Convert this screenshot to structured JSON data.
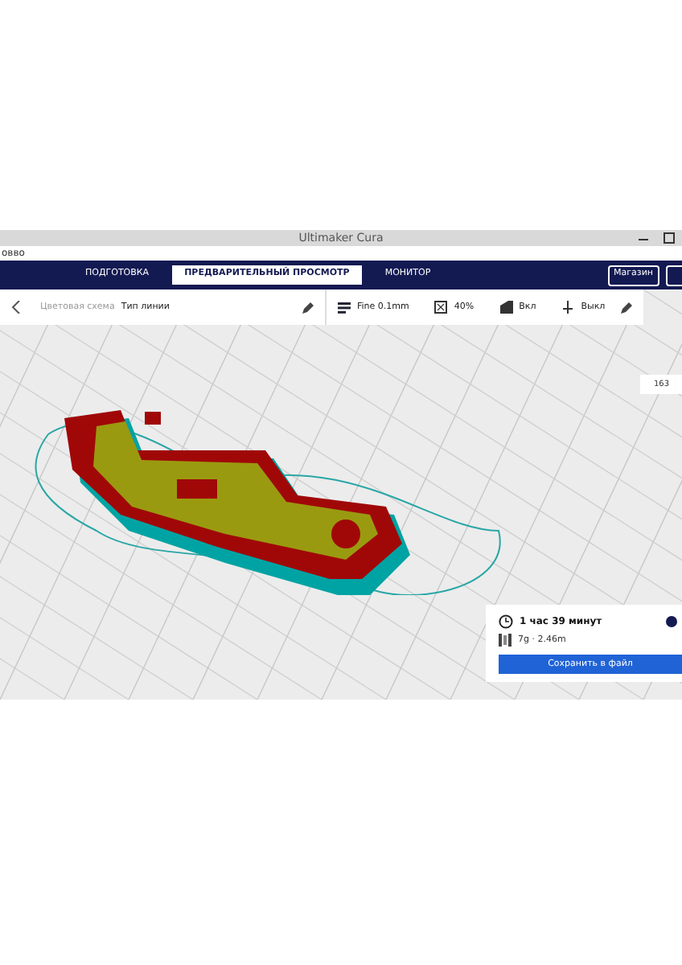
{
  "window": {
    "title": "Ultimaker Cura"
  },
  "menu_bar": {
    "items": [
      "овво"
    ]
  },
  "stages": [
    {
      "label": "ПОДГОТОВКА",
      "selected": false
    },
    {
      "label": "ПРЕДВАРИТЕЛЬНЫЙ ПРОСМОТР",
      "selected": true
    },
    {
      "label": "МОНИТОР",
      "selected": false
    }
  ],
  "header_buttons": [
    "Магазин"
  ],
  "view_panel": {
    "label": "Цветовая схема",
    "value": "Тип линии"
  },
  "print_setup": {
    "profile": "Fine 0.1mm",
    "infill": "40%",
    "support": "Вкл",
    "adhesion": "Выкл"
  },
  "layer_slider": {
    "value": "163"
  },
  "print_info": {
    "time": "1 час 39 минут",
    "material": "7g · 2.46m",
    "button": "Сохранить в файл"
  }
}
